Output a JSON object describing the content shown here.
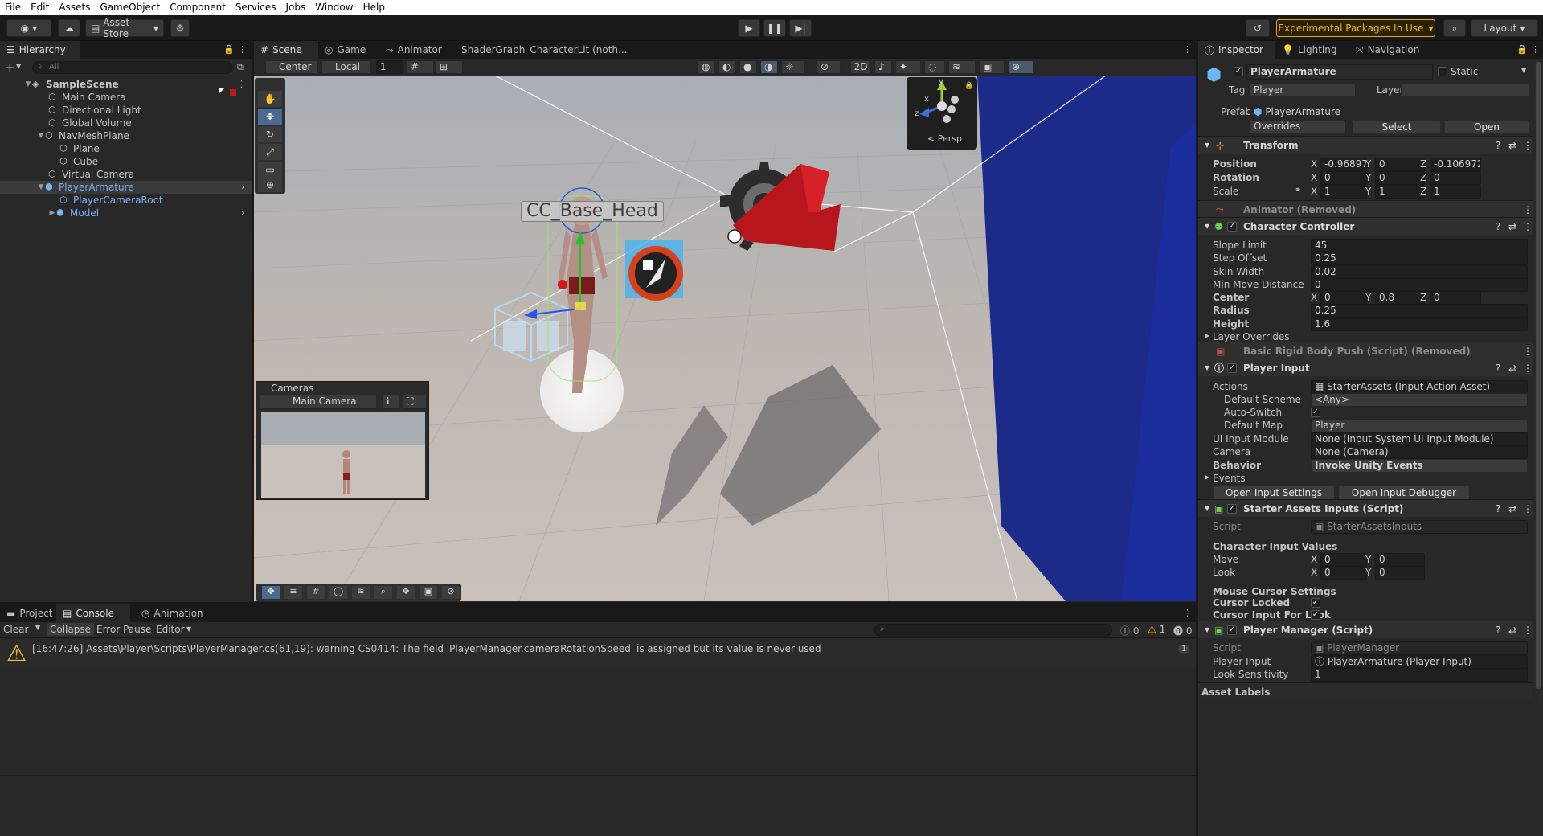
{
  "menu": [
    "File",
    "Edit",
    "Assets",
    "GameObject",
    "Component",
    "Services",
    "Jobs",
    "Window",
    "Help"
  ],
  "toolbar": {
    "asset_store": "Asset Store",
    "experimental": "Experimental Packages In Use",
    "layout": "Layout"
  },
  "hierarchy": {
    "tab": "Hierarchy",
    "search_placeholder": "All",
    "items": [
      {
        "label": "SampleScene"
      },
      {
        "label": "Main Camera"
      },
      {
        "label": "Directional Light"
      },
      {
        "label": "Global Volume"
      },
      {
        "label": "NavMeshPlane"
      },
      {
        "label": "Plane"
      },
      {
        "label": "Cube"
      },
      {
        "label": "Virtual Camera"
      },
      {
        "label": "PlayerArmature"
      },
      {
        "label": "PlayerCameraRoot"
      },
      {
        "label": "Model"
      }
    ]
  },
  "scene_tabs": {
    "scene": "Scene",
    "game": "Game",
    "animator": "Animator",
    "shadergraph": "ShaderGraph_CharacterLit (noth..."
  },
  "scene_toolbar": {
    "pivot": "Center",
    "space": "Local",
    "grid_value": "1",
    "mode_2d": "2D"
  },
  "scene": {
    "head_label": "CC_Base_Head",
    "gizmo_persp": "< Persp",
    "axis_y": "y",
    "axis_x": "x",
    "axis_z": "z",
    "cameras_overlay_title": "Cameras",
    "cameras_dropdown": "Main Camera"
  },
  "bottom_tabs": {
    "project": "Project",
    "console": "Console",
    "animation": "Animation"
  },
  "console": {
    "clear": "Clear",
    "collapse": "Collapse",
    "error_pause": "Error Pause",
    "editor": "Editor",
    "count_info": "0",
    "count_warn": "1",
    "count_err": "0",
    "message": "[16:47:26] Assets\\Player\\Scripts\\PlayerManager.cs(61,19): warning CS0414: The field 'PlayerManager.cameraRotationSpeed' is assigned but its value is never used",
    "message_count": "1"
  },
  "inspector_tabs": {
    "inspector": "Inspector",
    "lighting": "Lighting",
    "navigation": "Navigation"
  },
  "inspector": {
    "object_name": "PlayerArmature",
    "static": "Static",
    "tag_label": "Tag",
    "tag_value": "Player",
    "layer_label": "Layer",
    "prefab_label": "Prefab",
    "prefab_value": "PlayerArmature",
    "overrides": "Overrides",
    "select": "Select",
    "open": "Open",
    "transform": {
      "title": "Transform",
      "position": {
        "label": "Position",
        "x": "-0.96897",
        "y": "0",
        "z": "-0.106972"
      },
      "rotation": {
        "label": "Rotation",
        "x": "0",
        "y": "0",
        "z": "0"
      },
      "scale": {
        "label": "Scale",
        "x": "1",
        "y": "1",
        "z": "1"
      }
    },
    "animator_removed": "Animator (Removed)",
    "character_controller": {
      "title": "Character Controller",
      "slope_limit": {
        "label": "Slope Limit",
        "value": "45"
      },
      "step_offset": {
        "label": "Step Offset",
        "value": "0.25"
      },
      "skin_width": {
        "label": "Skin Width",
        "value": "0.02"
      },
      "min_move": {
        "label": "Min Move Distance",
        "value": "0"
      },
      "center": {
        "label": "Center",
        "x": "0",
        "y": "0.8",
        "z": "0"
      },
      "radius": {
        "label": "Radius",
        "value": "0.25"
      },
      "height": {
        "label": "Height",
        "value": "1.6"
      },
      "layer_overrides": "Layer Overrides"
    },
    "rigid_push_removed": "Basic Rigid Body Push (Script) (Removed)",
    "player_input": {
      "title": "Player Input",
      "actions": {
        "label": "Actions",
        "value": "StarterAssets (Input Action Asset)"
      },
      "default_scheme": {
        "label": "Default Scheme",
        "value": "<Any>"
      },
      "auto_switch": {
        "label": "Auto-Switch"
      },
      "default_map": {
        "label": "Default Map",
        "value": "Player"
      },
      "ui_input": {
        "label": "UI Input Module",
        "value": "None (Input System UI Input Module)"
      },
      "camera": {
        "label": "Camera",
        "value": "None (Camera)"
      },
      "behavior": {
        "label": "Behavior",
        "value": "Invoke Unity Events"
      },
      "events": "Events",
      "open_settings": "Open Input Settings",
      "open_debugger": "Open Input Debugger"
    },
    "starter_inputs": {
      "title": "Starter Assets Inputs (Script)",
      "script": {
        "label": "Script",
        "value": "StarterAssetsInputs"
      },
      "char_values": "Character Input Values",
      "move": {
        "label": "Move",
        "x": "0",
        "y": "0"
      },
      "look": {
        "label": "Look",
        "x": "0",
        "y": "0"
      },
      "mouse_settings": "Mouse Cursor Settings",
      "cursor_locked": "Cursor Locked",
      "cursor_input": "Cursor Input For Look"
    },
    "player_manager": {
      "title": "Player Manager (Script)",
      "script": {
        "label": "Script",
        "value": "PlayerManager"
      },
      "player_input": {
        "label": "Player Input",
        "value": "PlayerArmature (Player Input)"
      },
      "look_sens": {
        "label": "Look Sensitivity",
        "value": "1"
      }
    },
    "asset_labels": "Asset Labels"
  },
  "axis": {
    "x": "X",
    "y": "Y",
    "z": "Z"
  }
}
